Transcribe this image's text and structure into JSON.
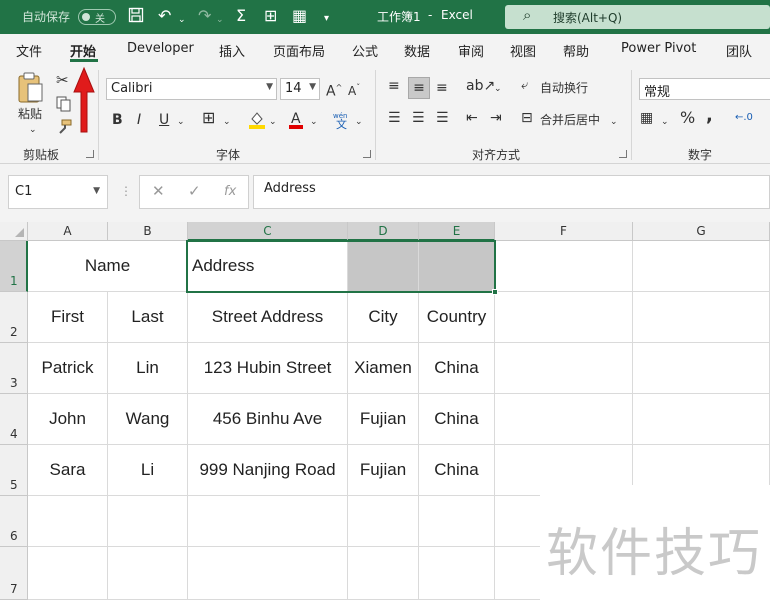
{
  "titlebar": {
    "autosave_label": "自动保存",
    "autosave_state": "关",
    "doc_title": "工作簿1",
    "separator": "-",
    "app_name": "Excel",
    "search_placeholder": "搜索(Alt+Q)"
  },
  "tabs": [
    "文件",
    "开始",
    "Developer",
    "插入",
    "页面布局",
    "公式",
    "数据",
    "审阅",
    "视图",
    "帮助",
    "Power Pivot",
    "团队"
  ],
  "active_tab": "开始",
  "ribbon": {
    "clipboard": {
      "label": "剪贴板",
      "paste_label": "粘贴"
    },
    "font": {
      "label": "字体",
      "font_name": "Calibri",
      "font_size": "14",
      "wen": "wén",
      "wen_char": "文"
    },
    "alignment": {
      "label": "对齐方式",
      "wrap_text": "自动换行",
      "merge_center": "合并后居中"
    },
    "number": {
      "label": "数字",
      "format": "常规"
    }
  },
  "formula_bar": {
    "name_box": "C1",
    "fx": "fx",
    "content": "Address"
  },
  "grid": {
    "columns": [
      "A",
      "B",
      "C",
      "D",
      "E",
      "F",
      "G"
    ],
    "rows": [
      "1",
      "2",
      "3",
      "4",
      "5",
      "6",
      "7"
    ],
    "cells": {
      "r1_name": "Name",
      "r1_address": "Address",
      "r2": [
        "First",
        "Last",
        "Street Address",
        "City",
        "Country"
      ],
      "r3": [
        "Patrick",
        "Lin",
        "123 Hubin Street",
        "Xiamen",
        "China"
      ],
      "r4": [
        "John",
        "Wang",
        "456 Binhu Ave",
        "Fujian",
        "China"
      ],
      "r5": [
        "Sara",
        "Li",
        "999 Nanjing Road",
        "Fujian",
        "China"
      ]
    }
  },
  "watermark": "软件技巧",
  "colors": {
    "excel_green": "#217346",
    "annotation_red": "#e01b1b"
  }
}
